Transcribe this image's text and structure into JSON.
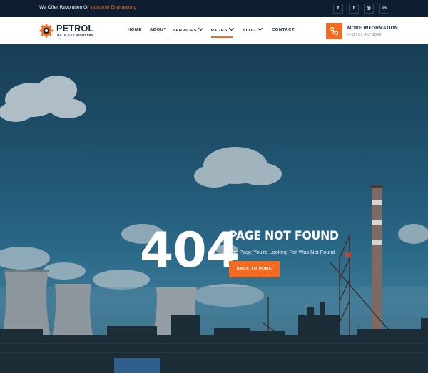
{
  "topbar": {
    "tagline_prefix": "We Offer Revolution Of ",
    "tagline_highlight": "Industrial Engineering",
    "social": [
      {
        "icon": "facebook-icon",
        "glyph": "f"
      },
      {
        "icon": "twitter-icon",
        "glyph": "t"
      },
      {
        "icon": "instagram-icon",
        "glyph": "◎"
      },
      {
        "icon": "linkedin-icon",
        "glyph": "in"
      }
    ]
  },
  "brand": {
    "title": "PETROL",
    "subtitle": "OIL & GAS INDUSTRY",
    "accent_color": "#f26b21",
    "dark_color": "#14243a"
  },
  "nav": {
    "home": "HOME",
    "about": "ABOUT",
    "services": "SERVICES",
    "pages": "PAGES",
    "blog": "BLOG",
    "contact": "CONTACT",
    "active": "PAGES"
  },
  "contact_info": {
    "title": "MORE INFORMATION",
    "phone": "(+62) 81 487 1843",
    "icon": "phone-icon"
  },
  "hero": {
    "code": "404",
    "title": "PAGE NOT FOUND",
    "subtitle": "The Page You're Looking For Was Not Found",
    "button_label": "BACK TO HOME"
  }
}
